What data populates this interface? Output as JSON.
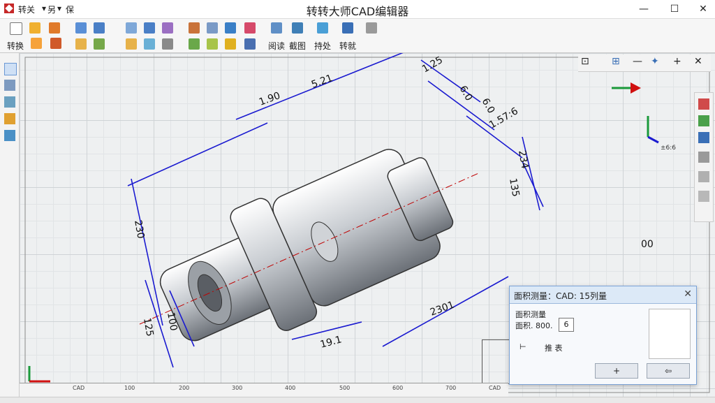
{
  "window": {
    "title": "转转大师CAD编辑器",
    "quick_access": [
      "转关",
      "另",
      "保"
    ]
  },
  "ribbon": {
    "label_left": "转换",
    "group_labels": [
      "阅读",
      "截图",
      "持处",
      "转就"
    ]
  },
  "drawing": {
    "dimensions": [
      "1.25",
      "5.21",
      "1.90",
      "6.0",
      "6.0",
      "1.57:6",
      "234",
      "135",
      "230",
      "125",
      "100",
      "2301",
      "19.1"
    ],
    "right_label": "00",
    "view_label": "±6:6"
  },
  "ruler": {
    "ticks": [
      "CAD",
      "100",
      "200",
      "300",
      "400",
      "500",
      "600",
      "700",
      "CAD"
    ]
  },
  "dialog": {
    "title": "面积测量：CAD: 15列量",
    "line1": "面积测量",
    "line2_label": "面积. 800.",
    "line2_value": "6",
    "row_label": "推  表",
    "ok_label": "+",
    "cancel_label": "⇦"
  },
  "colors": {
    "accent": "#1f5fbf",
    "dimension": "#1a1ad0",
    "centerline": "#c00000",
    "dialog_head": "#dce9f7"
  }
}
